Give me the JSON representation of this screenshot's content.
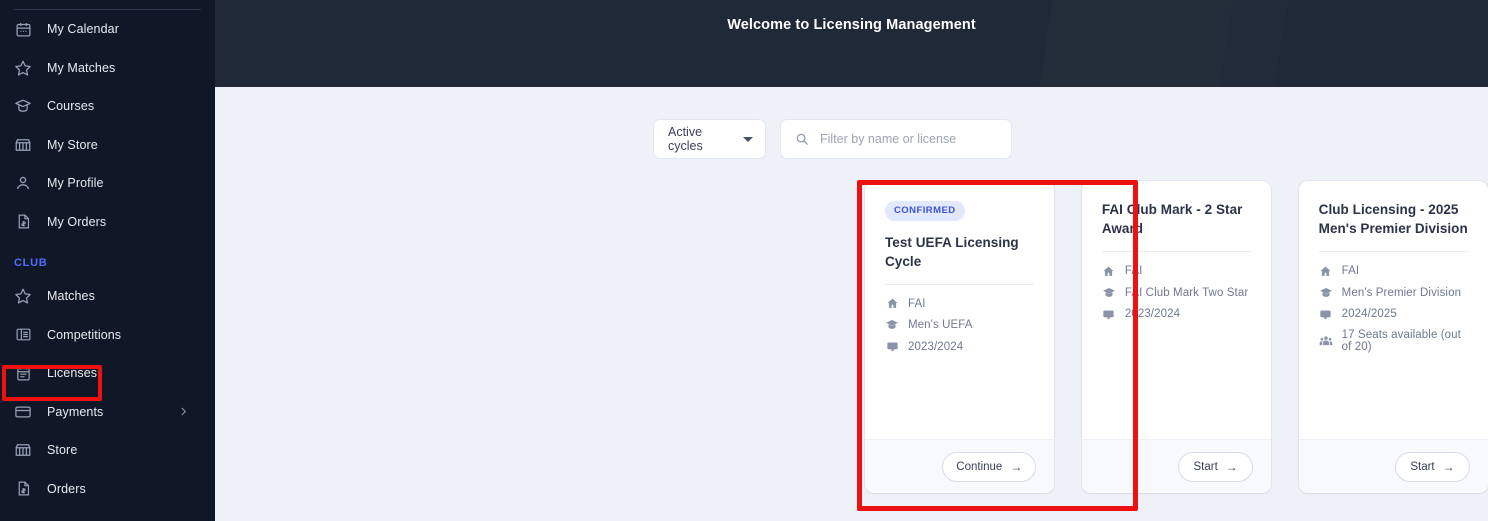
{
  "sidebar": {
    "personal_items": [
      {
        "label": "My Calendar",
        "icon": "calendar-icon"
      },
      {
        "label": "My Matches",
        "icon": "star-icon"
      },
      {
        "label": "Courses",
        "icon": "graduation-cap-icon"
      },
      {
        "label": "My Store",
        "icon": "store-icon"
      },
      {
        "label": "My Profile",
        "icon": "person-icon"
      },
      {
        "label": "My Orders",
        "icon": "invoice-icon"
      }
    ],
    "section_label": "CLUB",
    "club_items": [
      {
        "label": "Matches",
        "icon": "star-icon",
        "chevron": false
      },
      {
        "label": "Competitions",
        "icon": "list-icon",
        "chevron": false
      },
      {
        "label": "Licenses",
        "icon": "license-calendar-icon",
        "chevron": false
      },
      {
        "label": "Payments",
        "icon": "credit-card-icon",
        "chevron": true
      },
      {
        "label": "Store",
        "icon": "store-icon",
        "chevron": false
      },
      {
        "label": "Orders",
        "icon": "invoice-icon",
        "chevron": false
      }
    ],
    "highlight_color": "#ee1111",
    "section_color": "#4f6ef7",
    "background_color": "#101828"
  },
  "header": {
    "title": "Welcome to Licensing Management",
    "background_color": "#1f2937"
  },
  "toolbar": {
    "cycle_filter_label": "Active cycles",
    "cycle_filter_icon": "chevron-down-icon",
    "search_placeholder": "Filter by name or license",
    "search_value": "",
    "search_icon": "search-icon"
  },
  "cards": [
    {
      "badge": "CONFIRMED",
      "title": "Test UEFA Licensing Cycle",
      "meta": [
        {
          "icon": "home-icon",
          "text": "FAI"
        },
        {
          "icon": "graduation-cap-icon",
          "text": "Men's UEFA"
        },
        {
          "icon": "message-icon",
          "text": "2023/2024"
        }
      ],
      "action_label": "Continue",
      "action_arrow": "→",
      "highlighted": true
    },
    {
      "badge": "",
      "title": "FAI Club Mark - 2 Star Award",
      "meta": [
        {
          "icon": "home-icon",
          "text": "FAI"
        },
        {
          "icon": "graduation-cap-icon",
          "text": "FAI Club Mark Two Star"
        },
        {
          "icon": "message-icon",
          "text": "2023/2024"
        }
      ],
      "action_label": "Start",
      "action_arrow": "→",
      "highlighted": false
    },
    {
      "badge": "",
      "title": "Club Licensing - 2025 Men's Premier Division",
      "meta": [
        {
          "icon": "home-icon",
          "text": "FAI"
        },
        {
          "icon": "graduation-cap-icon",
          "text": "Men's Premier Division"
        },
        {
          "icon": "message-icon",
          "text": "2024/2025"
        },
        {
          "icon": "people-icon",
          "text": "17 Seats available (out of 20)"
        }
      ],
      "action_label": "Start",
      "action_arrow": "→",
      "highlighted": false
    }
  ],
  "colors": {
    "page_background": "#eef1f7",
    "card_background": "#ffffff",
    "badge_background": "#e2e8fd",
    "badge_text": "#3d53d6",
    "accent": "#4f6ef7",
    "highlight": "#ee1111"
  }
}
